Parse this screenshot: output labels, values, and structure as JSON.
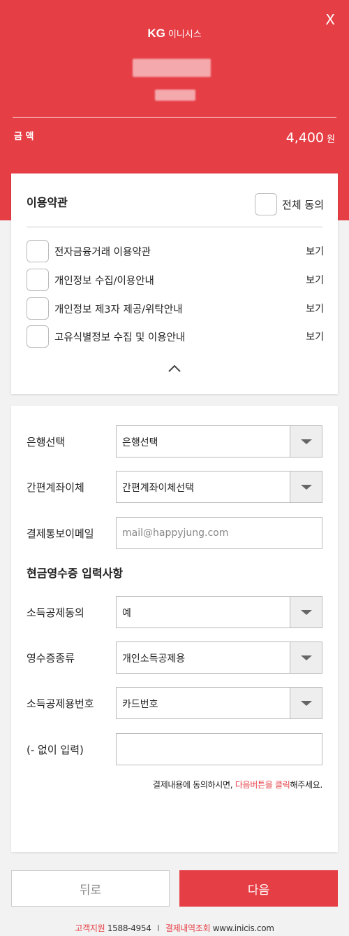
{
  "header": {
    "close_label": "X",
    "logo_brand": "KG",
    "logo_name": "이니시스",
    "amount_label": "금 액",
    "amount_value": "4,400",
    "amount_unit": "원"
  },
  "terms": {
    "title": "이용약관",
    "agree_all_label": "전체 동의",
    "items": [
      {
        "label": "전자금융거래 이용약관",
        "view": "보기"
      },
      {
        "label": "개인정보 수집/이용안내",
        "view": "보기"
      },
      {
        "label": "개인정보 제3자 제공/위탁안내",
        "view": "보기"
      },
      {
        "label": "고유식별정보 수집 및 이용안내",
        "view": "보기"
      }
    ]
  },
  "form": {
    "bank": {
      "label": "은행선택",
      "value": "은행선택"
    },
    "easy_transfer": {
      "label": "간편계좌이체",
      "value": "간편계좌이체선택"
    },
    "email": {
      "label": "결제통보이메일",
      "placeholder": "mail@happyjung.com",
      "value": ""
    },
    "cash_receipt_title": "현금영수증 입력사항",
    "deduction_consent": {
      "label": "소득공제동의",
      "value": "예"
    },
    "receipt_type": {
      "label": "영수증종류",
      "value": "개인소득공제용"
    },
    "deduction_number": {
      "label": "소득공제용번호",
      "value": "카드번호"
    },
    "no_dash_input": {
      "label": "(- 없이 입력)",
      "value": ""
    },
    "notice_prefix": "결제내용에 동의하시면, ",
    "notice_highlight": "다음버튼을 클릭",
    "notice_suffix": "해주세요."
  },
  "buttons": {
    "back_label": "뒤로",
    "next_label": "다음"
  },
  "footer": {
    "support_label": "고객지원",
    "support_phone": "1588-4954",
    "separator": "I",
    "history_label": "결제내역조회",
    "site": "www.inicis.com"
  },
  "colors": {
    "accent": "#e63e45"
  }
}
